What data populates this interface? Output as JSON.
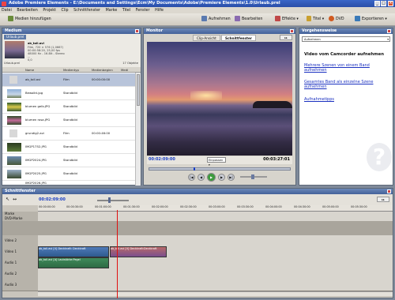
{
  "window": {
    "title": "Adobe Premiere Elements - E:\\Documents and Settings\\Ecm\\My Documents\\Adobe\\Premiere Elements\\1.0\\Urlaub.prel"
  },
  "menu": [
    "Datei",
    "Bearbeiten",
    "Projekt",
    "Clip",
    "Schnittfenster",
    "Marke",
    "Titel",
    "Fenster",
    "Hilfe"
  ],
  "toolbar": {
    "import": "Medien hinzufügen",
    "capture": "Aufnehmen",
    "edit": "Bearbeiten",
    "effects": "Effekte",
    "titles": "Titel",
    "dvd": "DVD",
    "export": "Exportieren"
  },
  "media": {
    "title": "Medium",
    "tab": "Urlaub.prel",
    "info": [
      "ab_toll.avi",
      "Film, 720 × 576 (1,0667)",
      "00:00:58:20, 25,00 fps",
      "48000 Hz - 16-Bit - Stereo",
      "...",
      "0,0"
    ],
    "folder": "Urlaub.prel",
    "count": "17 Objekte",
    "columns": [
      "Name",
      "Medientyp",
      "Medienbeginn",
      "Medi"
    ],
    "rows": [
      {
        "name": "ab_toll.avi",
        "type": "Film",
        "dur": "00:00:00:00"
      },
      {
        "name": "Bewolkt.jpg",
        "type": "Standbild",
        "dur": ""
      },
      {
        "name": "blumen gelb.JPG",
        "type": "Standbild",
        "dur": ""
      },
      {
        "name": "blumen rosa.JPG",
        "type": "Standbild",
        "dur": ""
      },
      {
        "name": "grundig2.avi",
        "type": "Film",
        "dur": "00:00:46:00"
      },
      {
        "name": "IMGP1752.JPG",
        "type": "Standbild",
        "dur": ""
      },
      {
        "name": "IMGP2024.JPG",
        "type": "Standbild",
        "dur": ""
      },
      {
        "name": "IMGP2025.JPG",
        "type": "Standbild",
        "dur": ""
      },
      {
        "name": "IMGP2026.JPG",
        "type": "Standbild",
        "dur": ""
      }
    ]
  },
  "monitor": {
    "title": "Monitor",
    "tab1": "Clip-Ansicht",
    "tab2": "Schnittfenster",
    "current_time": "00:02:09:00",
    "duration": "00:03:27:01",
    "zoom": "Einpassen"
  },
  "howto": {
    "title": "Vorgehensweise",
    "select": "Aufnehmen",
    "heading": "Video vom Camcorder aufnehmen",
    "links": [
      "Mehrere Szenen von einem Band aufnehmen",
      "Gesamtes Band als einzelne Szene aufnehmen",
      "Aufnahmetipps"
    ]
  },
  "timeline": {
    "title": "Schnittfenster",
    "current_time": "00:02:09:00",
    "ruler": [
      "00:00:00:00",
      "00:00:30:00",
      "00:01:00:00",
      "00:01:30:00",
      "00:02:00:00",
      "00:02:30:00",
      "00:03:00:00",
      "00:03:30:00",
      "00:04:00:00",
      "00:04:30:00",
      "00:05:00:00",
      "00:05:30:00"
    ],
    "tracks": [
      "Marke",
      "DVD-Marke",
      "Video 2",
      "Video 1",
      "Audio 1",
      "Audio 2",
      "Audio 3"
    ],
    "clip_v1a": "ab_toll.avi [V] Deckkraft: Deckkraft",
    "clip_v1b": "ab_toll.avi [V] Deckkraft:Deckkraft",
    "clip_a1": "ab_toll.avi [A] Lautstärke:Pegel"
  },
  "colors": {
    "accent": "#1a3ec4",
    "playhead": "#e01010",
    "title_bar": "#2a4ea8"
  }
}
